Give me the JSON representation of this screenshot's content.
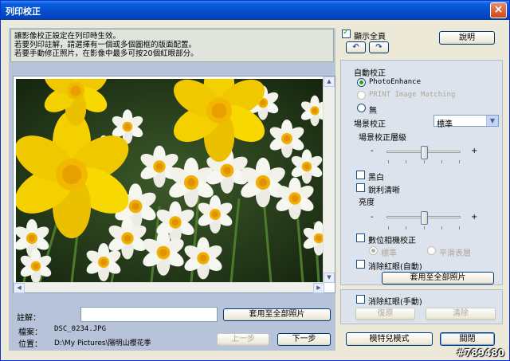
{
  "window": {
    "title": "列印校正"
  },
  "message": {
    "lines": [
      "讓影像校正設定在列印時生效。",
      "若要列印註解，請選擇有一個或多個圖框的版面配置。",
      "若要手動修正照片，在影像中最多可按20個紅眼部分。"
    ]
  },
  "bottom_left": {
    "comment_label": "註解：",
    "comment_value": "",
    "apply_all_label": "套用至全部照片",
    "file_label": "檔案：",
    "file_value": "DSC_0234.JPG",
    "location_label": "位置：",
    "location_value": "D:\\My Pictures\\陽明山櫻花季",
    "prev_label": "上一步",
    "next_label": "下一步"
  },
  "top_right": {
    "show_all_label": "顯示全頁",
    "show_all_checked": true,
    "help_label": "說明"
  },
  "auto_correct": {
    "heading": "自動校正",
    "options": [
      "PhotoEnhance",
      "PRINT Image Matching",
      "無"
    ],
    "selected": "PhotoEnhance"
  },
  "scene": {
    "label": "場景校正",
    "value": "標準",
    "level_label": "場景校正層級",
    "minus": "-",
    "plus": "+",
    "level": 0.5
  },
  "bw": {
    "label": "黑白",
    "checked": false
  },
  "sharpen": {
    "label": "銳利清晰",
    "checked": false
  },
  "brightness": {
    "label": "亮度",
    "minus": "-",
    "plus": "+",
    "level": 0.5
  },
  "digital_camera": {
    "label": "數位相機校正",
    "checked": false,
    "options": [
      "標準",
      "平滑表層"
    ],
    "selected": "標準"
  },
  "redeye_auto": {
    "label": "消除紅眼(自動)",
    "checked": false,
    "apply_all_label": "套用至全部照片"
  },
  "redeye_manual": {
    "label": "消除紅眼(手動)",
    "checked": false,
    "restore_label": "復原",
    "clear_label": "清除"
  },
  "footer": {
    "mode_label": "模特兒模式",
    "close_label": "關閉"
  },
  "watermark": "#789480",
  "colors": {
    "titlebar": "#0650d0",
    "accent_check": "#21a121",
    "daffodil": "#f5d000"
  }
}
